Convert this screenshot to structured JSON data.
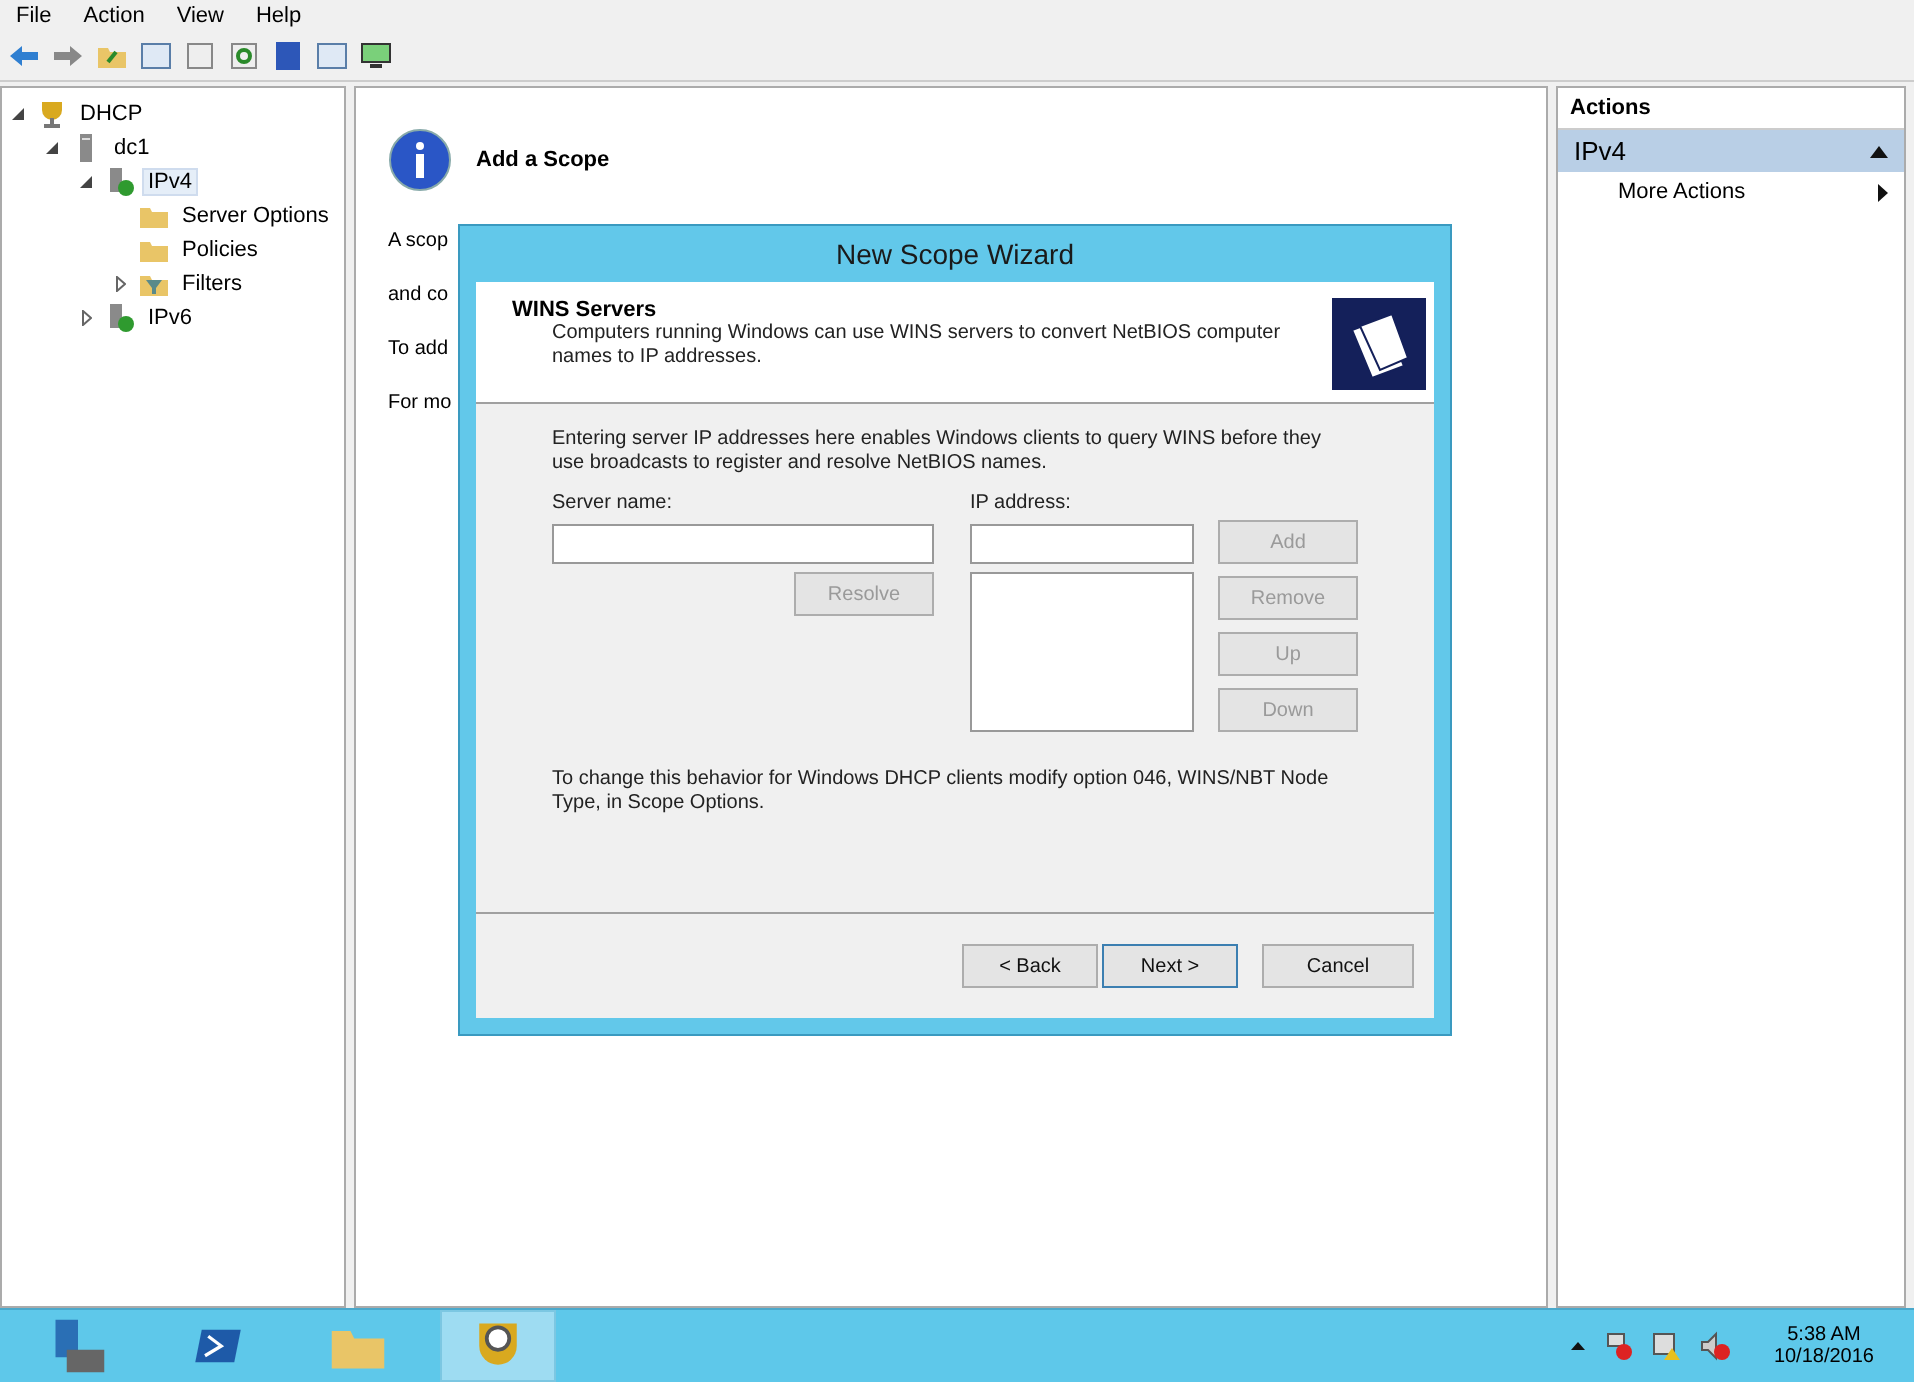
{
  "menu": [
    "File",
    "Action",
    "View",
    "Help"
  ],
  "tree": [
    {
      "label": "DHCP",
      "kind": "dhcp",
      "selected": false,
      "expanded": true,
      "children": [
        {
          "label": "dc1",
          "kind": "server",
          "selected": false,
          "expanded": true,
          "children": [
            {
              "label": "IPv4",
              "kind": "net",
              "selected": true,
              "expanded": true,
              "children": [
                {
                  "label": "Server Options",
                  "kind": "folder",
                  "selected": false
                },
                {
                  "label": "Policies",
                  "kind": "folder",
                  "selected": false
                },
                {
                  "label": "Filters",
                  "kind": "filter",
                  "selected": false,
                  "expanded": false
                }
              ]
            },
            {
              "label": "IPv6",
              "kind": "net",
              "selected": false,
              "expanded": false
            }
          ]
        }
      ]
    }
  ],
  "content": {
    "heading": "Add a Scope",
    "paragraphs": [
      "A scop",
      "and co",
      "To add",
      "For mo"
    ]
  },
  "dialog": {
    "title": "New Scope Wizard",
    "header_title": "WINS Servers",
    "header_text": "Computers running Windows can use WINS servers to convert NetBIOS computer names to IP addresses.",
    "intro": "Entering server IP addresses here enables Windows clients to query WINS before they use broadcasts to register and resolve NetBIOS names.",
    "server_label": "Server name:",
    "ip_label": "IP address:",
    "resolve": {
      "label": "Resolve",
      "disabled": true
    },
    "side_buttons": [
      {
        "label": "Add",
        "disabled": true
      },
      {
        "label": "Remove",
        "disabled": true
      },
      {
        "label": "Up",
        "disabled": true
      },
      {
        "label": "Down",
        "disabled": true
      }
    ],
    "note": "To change this behavior for Windows DHCP clients modify option 046, WINS/NBT Node Type, in Scope Options.",
    "footer_buttons": [
      {
        "label": "< Back",
        "default": false
      },
      {
        "label": "Next >",
        "default": true
      },
      {
        "label": "Cancel",
        "default": false
      }
    ]
  },
  "actions": {
    "title": "Actions",
    "group": "IPv4",
    "items": [
      "More Actions"
    ]
  },
  "taskbar": {
    "apps": [
      {
        "kind": "server",
        "selected": false
      },
      {
        "kind": "shell",
        "selected": false
      },
      {
        "kind": "folder",
        "selected": false
      },
      {
        "kind": "dhcp",
        "selected": true
      }
    ],
    "time": "5:38 AM",
    "date": "10/18/2016"
  }
}
